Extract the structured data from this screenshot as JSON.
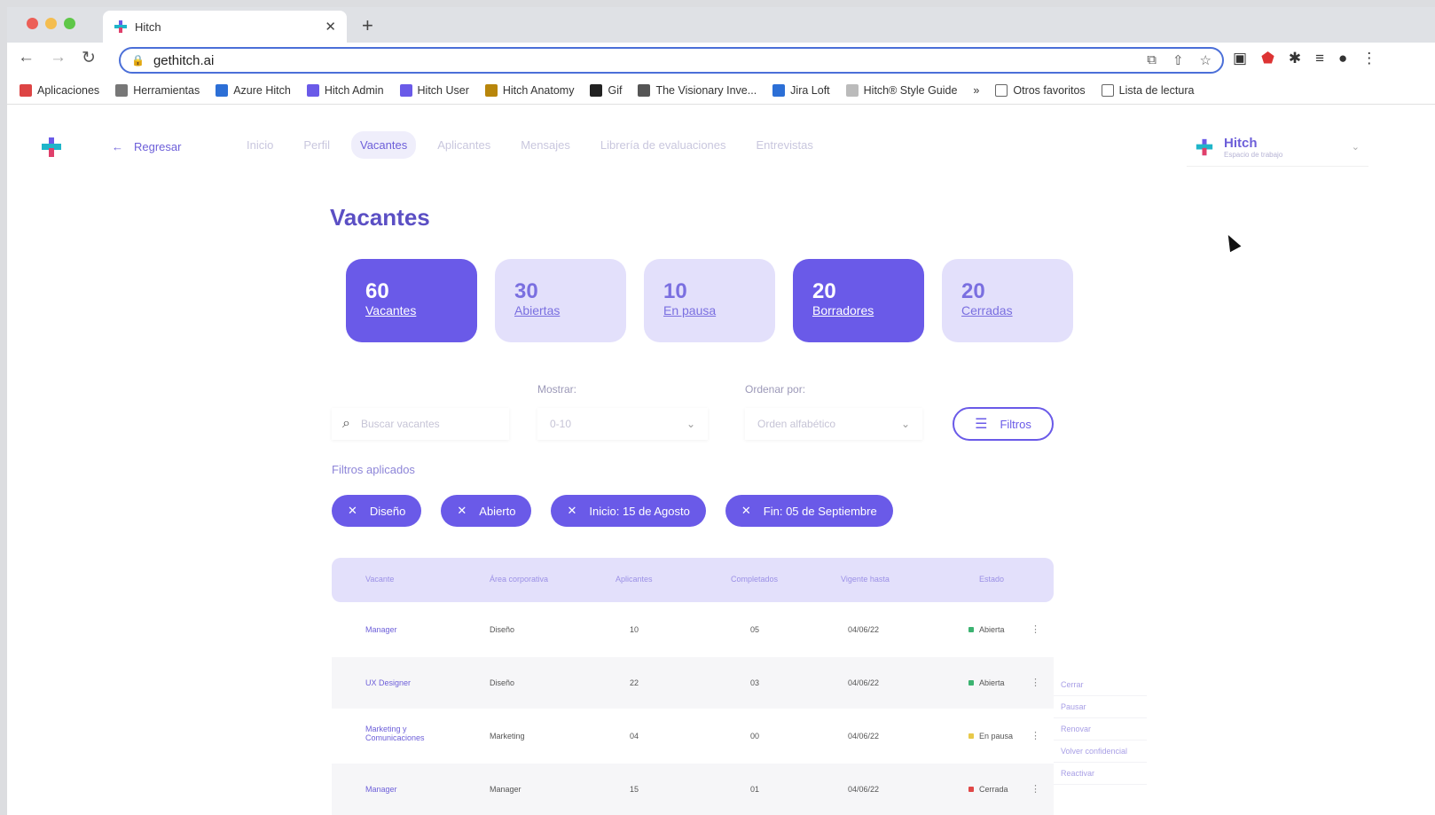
{
  "browser": {
    "tab_title": "Hitch",
    "tab_close": "✕",
    "new_tab": "+",
    "url": "gethitch.ai",
    "bookmarks": [
      {
        "label": "Aplicaciones",
        "color": "#d44"
      },
      {
        "label": "Herramientas",
        "color": "#777"
      },
      {
        "label": "Azure Hitch",
        "color": "#2c6fd6"
      },
      {
        "label": "Hitch Admin",
        "color": "#6a5ae8"
      },
      {
        "label": "Hitch User",
        "color": "#6a5ae8"
      },
      {
        "label": "Hitch Anatomy",
        "color": "#b8860b"
      },
      {
        "label": "Gif",
        "color": "#222"
      },
      {
        "label": "The Visionary Inve...",
        "color": "#555"
      },
      {
        "label": "Jira Loft",
        "color": "#2c6fd6"
      },
      {
        "label": "Hitch® Style Guide",
        "color": "#bbb"
      }
    ],
    "bookmarks_more": "»",
    "bookmarks_right": [
      {
        "label": "Otros favoritos"
      },
      {
        "label": "Lista de lectura"
      }
    ]
  },
  "nav": {
    "back_label": "Regresar",
    "links": [
      "Inicio",
      "Perfil",
      "Vacantes",
      "Aplicantes",
      "Mensajes",
      "Librería de evaluaciones",
      "Entrevistas"
    ],
    "active_index": 2
  },
  "profile": {
    "name": "Hitch",
    "subtitle": "Espacio de trabajo"
  },
  "page": {
    "title": "Vacantes"
  },
  "stats": [
    {
      "value": "60",
      "label": "Vacantes",
      "active": true
    },
    {
      "value": "30",
      "label": "Abiertas",
      "active": false
    },
    {
      "value": "10",
      "label": "En pausa",
      "active": false
    },
    {
      "value": "20",
      "label": "Borradores",
      "active": true
    },
    {
      "value": "20",
      "label": "Cerradas",
      "active": false
    }
  ],
  "controls": {
    "search_placeholder": "Buscar vacantes",
    "show_label": "Mostrar:",
    "show_value": "0-10",
    "sort_label": "Ordenar por:",
    "sort_value": "Orden alfabético",
    "filters_label": "Filtros",
    "applied_label": "Filtros aplicados"
  },
  "chips": [
    "Diseño",
    "Abierto",
    "Inicio: 15 de Agosto",
    "Fin: 05 de Septiembre"
  ],
  "table": {
    "headers": [
      "Vacante",
      "Área corporativa",
      "Aplicantes",
      "Completados",
      "Vigente hasta",
      "Estado"
    ],
    "rows": [
      {
        "vacante": "Manager",
        "area": "Diseño",
        "aplicantes": "10",
        "completados": "05",
        "vigente": "04/06/22",
        "estado": "Abierta",
        "estado_color": "#3cb371"
      },
      {
        "vacante": "UX Designer",
        "area": "Diseño",
        "aplicantes": "22",
        "completados": "03",
        "vigente": "04/06/22",
        "estado": "Abierta",
        "estado_color": "#3cb371"
      },
      {
        "vacante": "Marketing y Comunicaciones",
        "area": "Marketing",
        "aplicantes": "04",
        "completados": "00",
        "vigente": "04/06/22",
        "estado": "En pausa",
        "estado_color": "#e8c94a"
      },
      {
        "vacante": "Manager",
        "area": "Manager",
        "aplicantes": "15",
        "completados": "01",
        "vigente": "04/06/22",
        "estado": "Cerrada",
        "estado_color": "#e04848"
      }
    ]
  },
  "context_menu": [
    "Cerrar",
    "Pausar",
    "Renovar",
    "Volver confidencial",
    "Reactivar"
  ],
  "colors": {
    "accent": "#6a5ae8",
    "accent_light": "#e3e0fb",
    "title": "#5b4fc4"
  }
}
